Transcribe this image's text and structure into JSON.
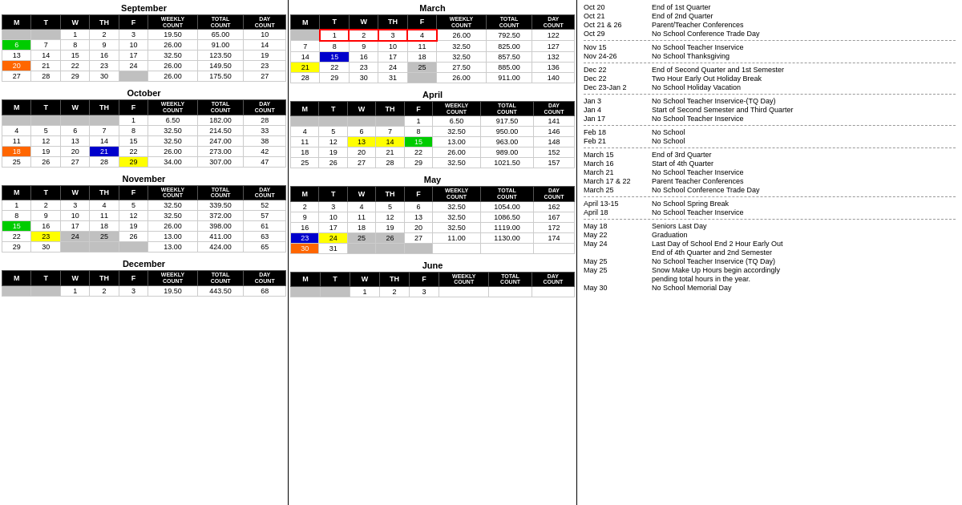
{
  "months_left": [
    {
      "name": "September",
      "headers": [
        "M",
        "T",
        "W",
        "TH",
        "F",
        "WEEKLY COUNT",
        "TOTAL COUNT",
        "DAY COUNT"
      ],
      "rows": [
        {
          "days": [
            "",
            "",
            "1",
            "2",
            "3"
          ],
          "weekly": "19.50",
          "total": "65.00",
          "day": "10"
        },
        {
          "days": [
            "6",
            "7",
            "8",
            "9",
            "10"
          ],
          "weekly": "26.00",
          "total": "91.00",
          "day": "14",
          "colors": {
            "0": "green-bg"
          }
        },
        {
          "days": [
            "13",
            "14",
            "15",
            "16",
            "17"
          ],
          "weekly": "32.50",
          "total": "123.50",
          "day": "19"
        },
        {
          "days": [
            "20",
            "21",
            "22",
            "23",
            "24"
          ],
          "weekly": "26.00",
          "total": "149.50",
          "day": "23",
          "colors": {
            "0": "orange-bg"
          }
        },
        {
          "days": [
            "27",
            "28",
            "29",
            "30",
            ""
          ],
          "weekly": "26.00",
          "total": "175.50",
          "day": "27"
        }
      ]
    },
    {
      "name": "October",
      "headers": [
        "M",
        "T",
        "W",
        "TH",
        "F",
        "WEEKLY COUNT",
        "TOTAL COUNT",
        "DAY COUNT"
      ],
      "rows": [
        {
          "days": [
            "",
            "",
            "",
            "",
            "1"
          ],
          "weekly": "6.50",
          "total": "182.00",
          "day": "28"
        },
        {
          "days": [
            "4",
            "5",
            "6",
            "7",
            "8"
          ],
          "weekly": "32.50",
          "total": "214.50",
          "day": "33"
        },
        {
          "days": [
            "11",
            "12",
            "13",
            "14",
            "15"
          ],
          "weekly": "32.50",
          "total": "247.00",
          "day": "38"
        },
        {
          "days": [
            "18",
            "19",
            "20",
            "21",
            "22"
          ],
          "weekly": "26.00",
          "total": "273.00",
          "day": "42",
          "colors": {
            "0": "orange-bg",
            "3": "blue-bg"
          }
        },
        {
          "days": [
            "25",
            "26",
            "27",
            "28",
            "29"
          ],
          "weekly": "34.00",
          "total": "307.00",
          "day": "47",
          "colors": {
            "4": "yellow-bg"
          }
        }
      ]
    },
    {
      "name": "November",
      "headers": [
        "M",
        "T",
        "W",
        "TH",
        "F",
        "WEEKLY COUNT",
        "TOTAL COUNT",
        "DAY COUNT"
      ],
      "rows": [
        {
          "days": [
            "1",
            "2",
            "3",
            "4",
            "5"
          ],
          "weekly": "32.50",
          "total": "339.50",
          "day": "52"
        },
        {
          "days": [
            "8",
            "9",
            "10",
            "11",
            "12"
          ],
          "weekly": "32.50",
          "total": "372.00",
          "day": "57"
        },
        {
          "days": [
            "15",
            "16",
            "17",
            "18",
            "19"
          ],
          "weekly": "26.00",
          "total": "398.00",
          "day": "61",
          "colors": {
            "0": "green-bg"
          }
        },
        {
          "days": [
            "22",
            "23",
            "24",
            "25",
            "26"
          ],
          "weekly": "13.00",
          "total": "411.00",
          "day": "63",
          "colors": {
            "1": "yellow-bg",
            "2": "gray-bg",
            "3": "gray-bg"
          }
        },
        {
          "days": [
            "29",
            "30",
            "",
            "",
            ""
          ],
          "weekly": "13.00",
          "total": "424.00",
          "day": "65"
        }
      ]
    },
    {
      "name": "December",
      "headers": [
        "M",
        "T",
        "W",
        "TH",
        "F",
        "WEEKLY COUNT",
        "TOTAL COUNT",
        "DAY COUNT"
      ],
      "rows": [
        {
          "days": [
            "",
            "",
            "1",
            "2",
            "3"
          ],
          "weekly": "19.50",
          "total": "443.50",
          "day": "68"
        }
      ]
    }
  ],
  "months_middle": [
    {
      "name": "March",
      "headers": [
        "M",
        "T",
        "W",
        "TH",
        "F",
        "WEEKLY COUNT",
        "TOTAL COUNT",
        "DAY COUNT"
      ],
      "rows": [
        {
          "days": [
            "",
            "1",
            "2",
            "3",
            "4"
          ],
          "weekly": "26.00",
          "total": "792.50",
          "day": "122",
          "redBorder": true
        },
        {
          "days": [
            "7",
            "8",
            "9",
            "10",
            "11"
          ],
          "weekly": "32.50",
          "total": "825.00",
          "day": "127"
        },
        {
          "days": [
            "14",
            "15",
            "16",
            "17",
            "18"
          ],
          "weekly": "32.50",
          "total": "857.50",
          "day": "132",
          "colors": {
            "1": "blue-bg"
          }
        },
        {
          "days": [
            "21",
            "22",
            "23",
            "24",
            "25"
          ],
          "weekly": "27.50",
          "total": "885.00",
          "day": "136",
          "colors": {
            "0": "yellow-bg",
            "4": "gray-bg"
          }
        },
        {
          "days": [
            "28",
            "29",
            "30",
            "31",
            ""
          ],
          "weekly": "26.00",
          "total": "911.00",
          "day": "140"
        }
      ]
    },
    {
      "name": "April",
      "headers": [
        "M",
        "T",
        "W",
        "TH",
        "F",
        "WEEKLY COUNT",
        "TOTAL COUNT",
        "DAY COUNT"
      ],
      "rows": [
        {
          "days": [
            "",
            "",
            "",
            "",
            "1"
          ],
          "weekly": "6.50",
          "total": "917.50",
          "day": "141"
        },
        {
          "days": [
            "4",
            "5",
            "6",
            "7",
            "8"
          ],
          "weekly": "32.50",
          "total": "950.00",
          "day": "146"
        },
        {
          "days": [
            "11",
            "12",
            "13",
            "14",
            "15"
          ],
          "weekly": "13.00",
          "total": "963.00",
          "day": "148",
          "colors": {
            "2": "yellow-bg",
            "3": "yellow-bg",
            "4": "green-bg"
          }
        },
        {
          "days": [
            "18",
            "19",
            "20",
            "21",
            "22"
          ],
          "weekly": "26.00",
          "total": "989.00",
          "day": "152"
        },
        {
          "days": [
            "25",
            "26",
            "27",
            "28",
            "29"
          ],
          "weekly": "32.50",
          "total": "1021.50",
          "day": "157"
        }
      ]
    },
    {
      "name": "May",
      "headers": [
        "M",
        "T",
        "W",
        "TH",
        "F",
        "WEEKLY COUNT",
        "TOTAL COUNT",
        "DAY COUNT"
      ],
      "rows": [
        {
          "days": [
            "2",
            "3",
            "4",
            "5",
            "6"
          ],
          "weekly": "32.50",
          "total": "1054.00",
          "day": "162"
        },
        {
          "days": [
            "9",
            "10",
            "11",
            "12",
            "13"
          ],
          "weekly": "32.50",
          "total": "1086.50",
          "day": "167"
        },
        {
          "days": [
            "16",
            "17",
            "18",
            "19",
            "20"
          ],
          "weekly": "32.50",
          "total": "1119.00",
          "day": "172"
        },
        {
          "days": [
            "23",
            "24",
            "25",
            "26",
            "27"
          ],
          "weekly": "11.00",
          "total": "1130.00",
          "day": "174",
          "colors": {
            "0": "blue-bg",
            "1": "yellow-bg",
            "2": "gray-bg",
            "3": "gray-bg"
          }
        },
        {
          "days": [
            "30",
            "31",
            "",
            "",
            ""
          ],
          "weekly": "",
          "total": "",
          "day": "",
          "colors": {
            "0": "orange-bg"
          }
        }
      ]
    },
    {
      "name": "June",
      "headers": [
        "M",
        "T",
        "W",
        "TH",
        "F",
        "WEEKLY COUNT",
        "TOTAL COUNT",
        "DAY COUNT"
      ],
      "rows": [
        {
          "days": [
            "",
            "",
            "1",
            "2",
            "3"
          ],
          "weekly": "",
          "total": "",
          "day": ""
        }
      ]
    }
  ],
  "events": [
    {
      "date": "Oct 20",
      "desc": "End of 1st Quarter"
    },
    {
      "date": "Oct 21",
      "desc": "End of 2nd Quarter"
    },
    {
      "date": "Oct 21 & 26",
      "desc": "Parent/Teacher Conferences"
    },
    {
      "date": "Oct 29",
      "desc": "No School Conference Trade Day"
    },
    {
      "date": "---",
      "desc": ""
    },
    {
      "date": "Nov 15",
      "desc": "No School Teacher Inservice"
    },
    {
      "date": "Nov 24-26",
      "desc": "No School Thanksgiving"
    },
    {
      "date": "---",
      "desc": ""
    },
    {
      "date": "Dec 22",
      "desc": "End of Second Quarter and 1st Semester"
    },
    {
      "date": "Dec 22",
      "desc": "Two Hour Early Out Holiday Break"
    },
    {
      "date": "Dec 23-Jan 2",
      "desc": "No School Holiday Vacation"
    },
    {
      "date": "---",
      "desc": ""
    },
    {
      "date": "Jan 3",
      "desc": "No School Teacher Inservice-(TQ Day)"
    },
    {
      "date": "Jan 4",
      "desc": "Start of Second Semester and Third Quarter"
    },
    {
      "date": "Jan 17",
      "desc": "No School Teacher Inservice"
    },
    {
      "date": "---",
      "desc": ""
    },
    {
      "date": "Feb 18",
      "desc": "No School"
    },
    {
      "date": "Feb 21",
      "desc": "No School"
    },
    {
      "date": "---",
      "desc": ""
    },
    {
      "date": "March 15",
      "desc": "End of 3rd Quarter"
    },
    {
      "date": "March 16",
      "desc": "Start of 4th Quarter"
    },
    {
      "date": "March 21",
      "desc": "No School Teacher Inservice"
    },
    {
      "date": "March 17 & 22",
      "desc": "Parent Teacher Conferences"
    },
    {
      "date": "March 25",
      "desc": "No School Conference Trade Day"
    },
    {
      "date": "---",
      "desc": ""
    },
    {
      "date": "April 13-15",
      "desc": "No School Spring Break"
    },
    {
      "date": "April 18",
      "desc": "No School Teacher Inservice"
    },
    {
      "date": "---",
      "desc": ""
    },
    {
      "date": "May 18",
      "desc": "Seniors Last Day"
    },
    {
      "date": "May 22",
      "desc": "Graduation"
    },
    {
      "date": "May 24",
      "desc": "Last Day of School End 2 Hour Early Out"
    },
    {
      "date": "",
      "desc": "End of 4th Quarter and 2nd Semester"
    },
    {
      "date": "May 25",
      "desc": "No School Teacher Inservice (TQ Day)"
    },
    {
      "date": "May 25",
      "desc": "Snow Make Up Hours begin accordingly"
    },
    {
      "date": "",
      "desc": "pending total hours in the year."
    },
    {
      "date": "May 30",
      "desc": "No School Memorial Day"
    }
  ]
}
